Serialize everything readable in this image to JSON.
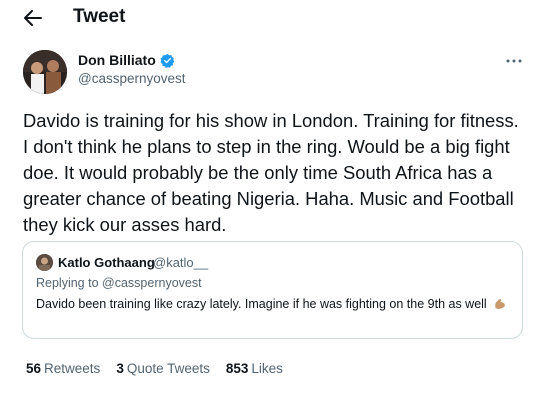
{
  "header": {
    "back_icon": "arrow-left-icon",
    "title": "Tweet"
  },
  "tweet": {
    "author_name": "Don Billiato",
    "author_handle": "@casspernyovest",
    "verified_icon": "verified-badge-icon",
    "more_icon": "more-options-icon",
    "text": "Davido is training for his show in London. Training for fitness. I don't think he plans to step in the ring. Would be a big fight doe. It would probably be the only time South Africa has a greater chance of beating Nigeria. Haha. Music and Football they kick our asses hard.",
    "quote": {
      "author_name": "Katlo Gothaang",
      "author_handle": "@katlo__",
      "reply_prefix": "Replying to",
      "reply_to": "@casspernyovest",
      "text": "Davido been training like crazy lately. Imagine if he was fighting on the 9th as well",
      "emoji_icon": "flexed-biceps-emoji"
    },
    "stats": {
      "retweets_count": "56",
      "retweets_label": "Retweets",
      "quotes_count": "3",
      "quotes_label": "Quote Tweets",
      "likes_count": "853",
      "likes_label": "Likes"
    }
  },
  "colors": {
    "text_primary": "#0f1419",
    "text_secondary": "#536471",
    "verified_blue": "#1d9bf0",
    "border": "#cfd9de"
  }
}
